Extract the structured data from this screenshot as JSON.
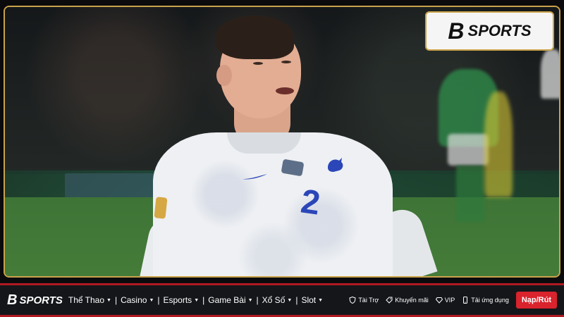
{
  "brand": {
    "logo_mark": "B",
    "logo_text": "SPORTS"
  },
  "hero": {
    "shirt_number": "2"
  },
  "nav": {
    "menu": [
      {
        "label": "Thể Thao",
        "has_dropdown": true
      },
      {
        "label": "Casino",
        "has_dropdown": true
      },
      {
        "label": "Esports",
        "has_dropdown": true
      },
      {
        "label": "Game Bài",
        "has_dropdown": true
      },
      {
        "label": "Xổ Số",
        "has_dropdown": true
      },
      {
        "label": "Slot",
        "has_dropdown": true
      }
    ],
    "separator": "|",
    "links": [
      {
        "label": "Tài Trợ",
        "icon": "shield-icon"
      },
      {
        "label": "Khuyến mãi",
        "icon": "tag-icon"
      },
      {
        "label": "VIP",
        "icon": "diamond-icon"
      },
      {
        "label": "Tải ứng dụng",
        "icon": "phone-icon"
      }
    ],
    "cta_label": "Nạp/Rút"
  },
  "colors": {
    "accent_gold": "#c9a24a",
    "brand_red": "#d9232d",
    "nav_bg": "#15161a"
  }
}
